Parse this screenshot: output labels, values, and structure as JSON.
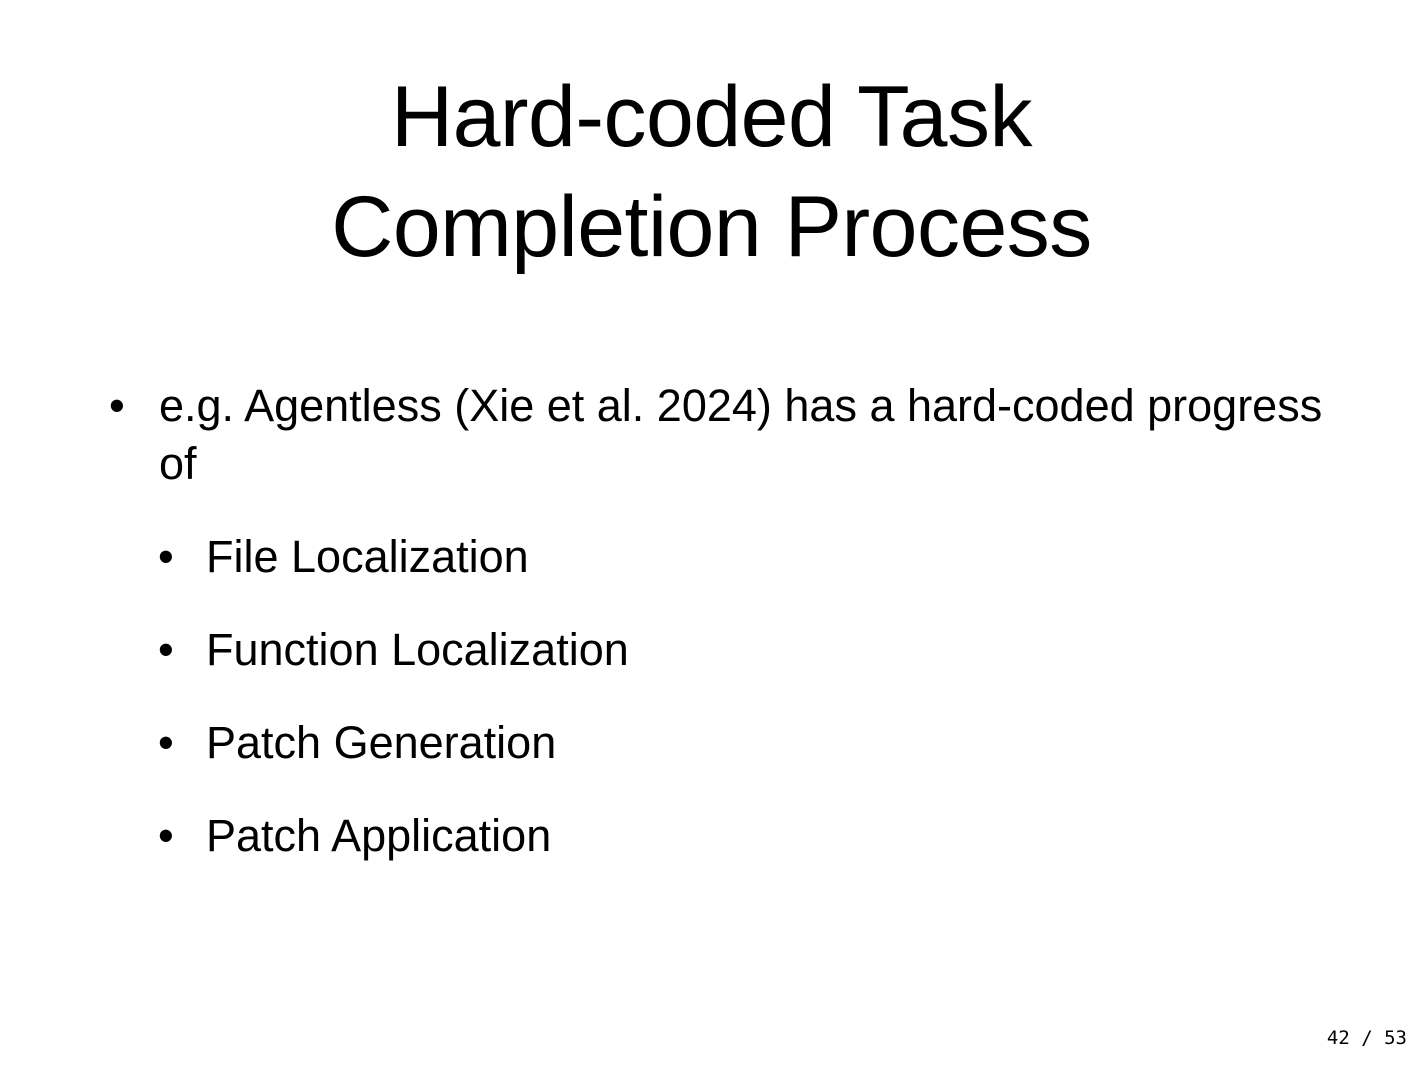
{
  "slide": {
    "title_line_1": "Hard-coded Task",
    "title_line_2": "Completion Process",
    "bullet_main": "e.g. Agentless (Xie et al. 2024) has a hard-coded progress of",
    "sub_bullets": [
      {
        "text": "File Localization"
      },
      {
        "text": "Function Localization"
      },
      {
        "text": "Patch Generation"
      },
      {
        "text": "Patch Application"
      }
    ],
    "bullet_glyph": "•",
    "page_indicator": "42 / 53"
  }
}
